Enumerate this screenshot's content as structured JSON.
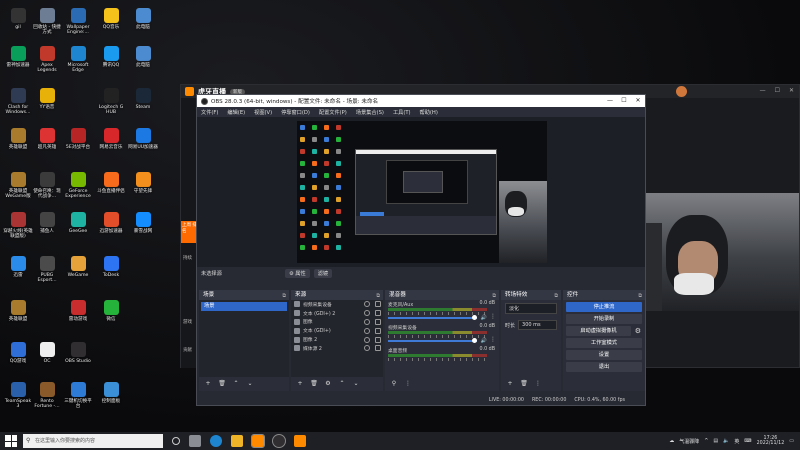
{
  "desktop": {
    "icons": [
      {
        "label": "gil",
        "color": "#333"
      },
      {
        "label": "回收站 - 快捷方式",
        "color": "#6d7d93"
      },
      {
        "label": "Wallpaper Engine:...",
        "color": "#2b6bb3"
      },
      {
        "label": "QQ音乐",
        "color": "#f4c21b"
      },
      {
        "label": "此电脑",
        "color": "#4c8bd0"
      },
      {
        "label": "雷神加速器",
        "color": "#0a9e5b"
      },
      {
        "label": "Apex Legends",
        "color": "#c0392b"
      },
      {
        "label": "Microsoft Edge",
        "color": "#1e86d1"
      },
      {
        "label": "腾讯QQ",
        "color": "#1a9bf0"
      },
      {
        "label": "此电脑",
        "color": "#4c8bd0"
      },
      {
        "label": "Clash for Windows...",
        "color": "#2f3b52"
      },
      {
        "label": "YY语音",
        "color": "#e7b10a"
      },
      {
        "label": "Logitech G HUB",
        "color": "#222"
      },
      {
        "label": "Steam",
        "color": "#1b2838"
      },
      {
        "label": "英雄联盟",
        "color": "#a87c2c"
      },
      {
        "label": "超凡英雄",
        "color": "#d33"
      },
      {
        "label": "5E对战平台",
        "color": "#b82525"
      },
      {
        "label": "网易云音乐",
        "color": "#d7272b"
      },
      {
        "label": "网易UU加速器",
        "color": "#1c79e3"
      },
      {
        "label": "英雄联盟 WeGame版",
        "color": "#a87c2c"
      },
      {
        "label": "使命召唤：现代战争...",
        "color": "#3b3b3b"
      },
      {
        "label": "GeForce Experience",
        "color": "#76b900"
      },
      {
        "label": "斗鱼直播伴侣",
        "color": "#f76b1c"
      },
      {
        "label": "守望先锋",
        "color": "#f38f1c"
      },
      {
        "label": "穿越火线(英雄联盟版)",
        "color": "#a33"
      },
      {
        "label": "捕鱼人",
        "color": "#444"
      },
      {
        "label": "GeeGee",
        "color": "#1db2a2"
      },
      {
        "label": "迅游加速器",
        "color": "#e34e2a"
      },
      {
        "label": "暴雪战网",
        "color": "#148eff"
      },
      {
        "label": "迅雷",
        "color": "#2b8be8"
      },
      {
        "label": "PUBG Esport...",
        "color": "#4b4b4b"
      },
      {
        "label": "WeGame",
        "color": "#e5a13a"
      },
      {
        "label": "ToDesk",
        "color": "#2c74f1"
      },
      {
        "label": "英雄联盟",
        "color": "#a87c2c"
      },
      {
        "label": "雷动游戏",
        "color": "#c92d2d"
      },
      {
        "label": "微信",
        "color": "#26b33b"
      },
      {
        "label": "QQ游戏",
        "color": "#2e6ed6"
      },
      {
        "label": "OC",
        "color": "#eee"
      },
      {
        "label": "OBS Studio",
        "color": "#302e31"
      },
      {
        "label": "TeamSpeak 3",
        "color": "#2a5fa9"
      },
      {
        "label": "Rento Fortune -...",
        "color": "#8a5a2a"
      },
      {
        "label": "三键机切换平台",
        "color": "#2e7bd6"
      },
      {
        "label": "控制面板",
        "color": "#3a8fd6"
      }
    ]
  },
  "bg_app": {
    "brand": "虎牙直播",
    "badge": "新版",
    "tab_label": "上周 排名",
    "strip_labels": [
      "持续",
      "游戏",
      "贡献"
    ]
  },
  "obs": {
    "title": "OBS 28.0.3 (64-bit, windows) - 配置文件: 未命名 - 场景: 未命名",
    "menu": [
      "文件(F)",
      "编辑(E)",
      "视图(V)",
      "停靠窗口(D)",
      "配置文件(P)",
      "场景集合(S)",
      "工具(T)",
      "帮助(H)"
    ],
    "ctx": {
      "no_source": "未选择源",
      "props": "⚙ 属性",
      "filters": "滤镜"
    },
    "docks": {
      "scenes": {
        "title": "场景",
        "items": [
          "场景"
        ]
      },
      "sources": {
        "title": "来源",
        "items": [
          "视频采集设备",
          "文本 (GDI+) 2",
          "图像",
          "文本 (GDI+)",
          "图像 2",
          "媒体源 2"
        ]
      },
      "mixer": {
        "title": "混音器",
        "channels": [
          {
            "name": "麦克风/Aux",
            "db": "0.0 dB"
          },
          {
            "name": "视频采集设备",
            "db": "0.0 dB"
          },
          {
            "name": "桌面音频",
            "db": "0.0 dB"
          }
        ]
      },
      "transitions": {
        "title": "转场特效",
        "type": "淡化",
        "duration_label": "时长",
        "duration": "300 ms"
      },
      "controls": {
        "title": "控件",
        "buttons": [
          "停止推流",
          "开始录制",
          "启动虚拟摄像机",
          "工作室模式",
          "设置",
          "退出"
        ]
      }
    },
    "status": {
      "live": "LIVE: 00:00:00",
      "rec": "REC: 00:00:00",
      "cpu": "CPU: 0.4%, 60.00 fps"
    }
  },
  "taskbar": {
    "search_placeholder": "在这里输入你要搜索的内容",
    "weather": "气温骤降",
    "time": "17:26",
    "date": "2022/11/12",
    "lang": "英"
  }
}
